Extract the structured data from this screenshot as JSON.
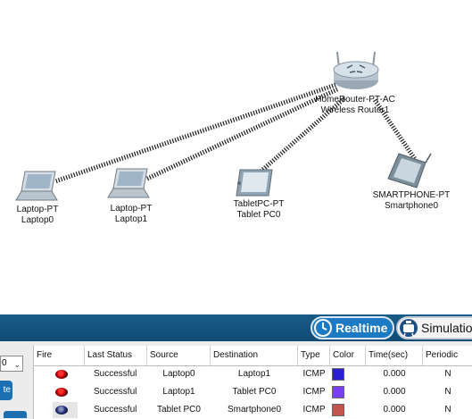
{
  "devices": [
    {
      "model": "HomeRouter-PT-AC",
      "name": "Wireless Router1",
      "icon": "wireless-router-icon"
    },
    {
      "model": "Laptop-PT",
      "name": "Laptop0",
      "icon": "laptop-icon"
    },
    {
      "model": "Laptop-PT",
      "name": "Laptop1",
      "icon": "laptop-icon"
    },
    {
      "model": "TabletPC-PT",
      "name": "Tablet PC0",
      "icon": "tablet-icon"
    },
    {
      "model": "SMARTPHONE-PT",
      "name": "Smartphone0",
      "icon": "smartphone-icon"
    }
  ],
  "mode_bar": {
    "realtime_label": "Realtime",
    "simulation_label": "Simulation",
    "realtime_icon": "clock-icon",
    "simulation_icon": "stopwatch-icon"
  },
  "left_controls": {
    "scenario_value": "0",
    "delete_label": "te"
  },
  "pdu_table": {
    "columns": [
      "Fire",
      "Last Status",
      "Source",
      "Destination",
      "Type",
      "Color",
      "Time(sec)",
      "Periodic"
    ],
    "rows": [
      {
        "status": "Successful",
        "source": "Laptop0",
        "destination": "Laptop1",
        "type": "ICMP",
        "color": "#2b1fd6",
        "time": "0.000",
        "periodic": "N"
      },
      {
        "status": "Successful",
        "source": "Laptop1",
        "destination": "Tablet PC0",
        "type": "ICMP",
        "color": "#7a3ff0",
        "time": "0.000",
        "periodic": "N"
      },
      {
        "status": "Successful",
        "source": "Tablet PC0",
        "destination": "Smartphone0",
        "type": "ICMP",
        "color": "#c0554e",
        "time": "0.000",
        "periodic": "N"
      }
    ]
  },
  "colors": {
    "bar_blue": "#0f4b75",
    "button_blue": "#1c7ac2",
    "link_color": "#1a1a1a"
  }
}
